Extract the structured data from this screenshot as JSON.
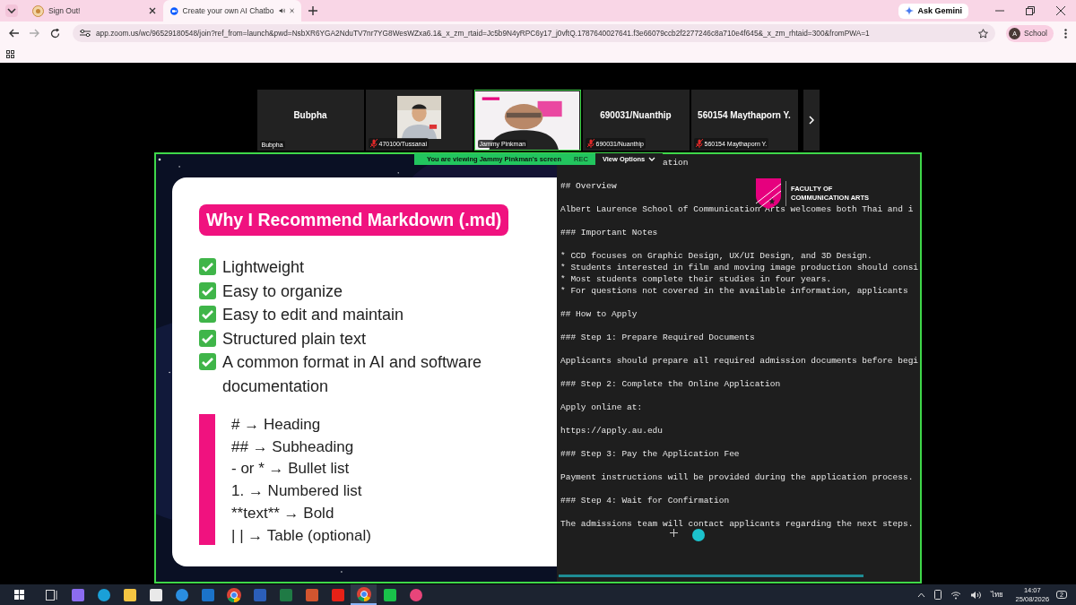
{
  "browser": {
    "tabs": [
      {
        "title": "Sign Out!",
        "kind": "generic",
        "audio": false,
        "selected": false
      },
      {
        "title": "Create your own AI Chatbo",
        "kind": "zoom",
        "audio": true,
        "selected": true
      }
    ],
    "url": "app.zoom.us/wc/96529180548/join?ref_from=launch&pwd=NsbXR6YGA2NduTV7nr7YG8WesWZxa6.1&_x_zm_rtaid=Jc5b9N4yRPC6y17_j0vftQ.1787640027641.f3e66079ccb2f2277246c8a710e4f645&_x_zm_rhtaid=300&fromPWA=1",
    "ask_button": "Ask Gemini",
    "profile": {
      "initial": "A",
      "name": "School"
    }
  },
  "participants": [
    {
      "name": "Bubpha",
      "label": "Bubpha",
      "muted": false,
      "video": false,
      "speaking": false
    },
    {
      "label": "470100/Tussanai",
      "muted": true,
      "video": true,
      "speaking": false
    },
    {
      "label": "Jammy Pinkman",
      "muted": false,
      "video": true,
      "speaking": true
    },
    {
      "name": "690031/Nuanthip",
      "label": "690031/Nuanthip",
      "muted": true,
      "video": false,
      "speaking": false
    },
    {
      "name": "560154 Maythaporn Y.",
      "label": "560154 Maythaporn Y.",
      "muted": true,
      "video": false,
      "speaking": false
    }
  ],
  "share_banner": {
    "text": "You are viewing  Jammy Pinkman's screen",
    "rec": "REC",
    "view_options": "View Options"
  },
  "slide": {
    "title": "Why I Recommend Markdown (.md)",
    "benefits": [
      "Lightweight",
      "Easy to organize",
      "Easy to edit and maintain",
      "Structured plain text",
      "A common format in AI and software documentation"
    ],
    "syntax": [
      "# → Heading",
      "## → Subheading",
      "- or * → Bullet list",
      "1. → Numbered list",
      "**text** → Bold",
      "| | → Table (optional)"
    ]
  },
  "editor": {
    "logo": [
      "FACULTY OF",
      "COMMUNICATION ARTS"
    ],
    "blocks": [
      [
        "ation"
      ],
      [
        "## Overview"
      ],
      [
        "Albert Laurence School of Communication Arts welcomes both Thai and i"
      ],
      [
        "### Important Notes"
      ],
      [
        "* CCD focuses on Graphic Design, UX/UI Design, and 3D Design.",
        "* Students interested in film and moving image production should consi",
        "* Most students complete their studies in four years.",
        "* For questions not covered in the available information, applicants"
      ],
      [
        "## How to Apply"
      ],
      [
        "### Step 1: Prepare Required Documents"
      ],
      [
        "Applicants should prepare all required admission documents before begi"
      ],
      [
        "### Step 2: Complete the Online Application"
      ],
      [
        "Apply online at:"
      ],
      [
        "https://apply.au.edu"
      ],
      [
        "### Step 3: Pay the Application Fee"
      ],
      [
        "Payment instructions will be provided during the application process."
      ],
      [
        "### Step 4: Wait for Confirmation"
      ],
      [
        "The admissions team will contact applicants regarding the next steps."
      ]
    ]
  },
  "taskbar": {
    "apps": [
      {
        "kind": "taskview",
        "active": false
      },
      {
        "kind": "copilot",
        "active": false
      },
      {
        "kind": "edge",
        "active": false
      },
      {
        "kind": "explorer",
        "active": false
      },
      {
        "kind": "store",
        "active": false
      },
      {
        "kind": "ie",
        "active": false
      },
      {
        "kind": "outlook",
        "active": false
      },
      {
        "kind": "chrome",
        "active": false
      },
      {
        "kind": "word",
        "active": false
      },
      {
        "kind": "excel",
        "active": false
      },
      {
        "kind": "powerpoint",
        "active": false
      },
      {
        "kind": "youtube",
        "active": false
      },
      {
        "kind": "chrome",
        "active": true
      },
      {
        "kind": "line",
        "active": false
      },
      {
        "kind": "drop",
        "active": false
      }
    ],
    "language": "ไทย",
    "time": "14:07",
    "date": "25/08/2026",
    "notifications": "2"
  }
}
